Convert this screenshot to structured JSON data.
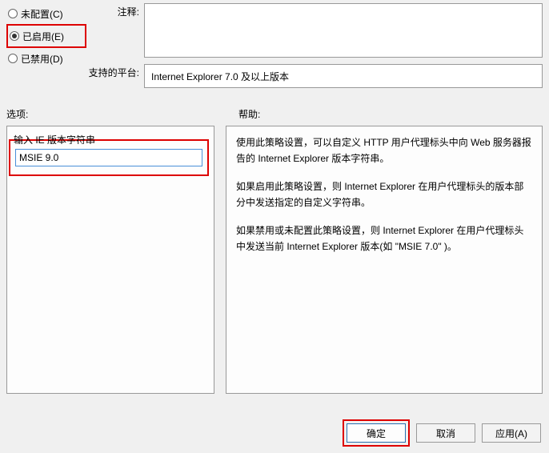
{
  "radios": {
    "not_configured": "未配置(C)",
    "enabled": "已启用(E)",
    "disabled": "已禁用(D)"
  },
  "labels": {
    "comment": "注释:",
    "platform": "支持的平台:",
    "options": "选项:",
    "help": "帮助:",
    "input_caption": "输入 IE 版本字符串"
  },
  "values": {
    "platform": "Internet Explorer 7.0 及以上版本",
    "ie_version_input": "MSIE 9.0"
  },
  "help_text": {
    "p1": "使用此策略设置，可以自定义 HTTP 用户代理标头中向 Web 服务器报告的 Internet Explorer 版本字符串。",
    "p2": "如果启用此策略设置，则 Internet Explorer 在用户代理标头的版本部分中发送指定的自定义字符串。",
    "p3": "如果禁用或未配置此策略设置，则 Internet Explorer 在用户代理标头中发送当前 Internet Explorer 版本(如 \"MSIE 7.0\" )。"
  },
  "buttons": {
    "ok": "确定",
    "cancel": "取消",
    "apply": "应用(A)"
  }
}
